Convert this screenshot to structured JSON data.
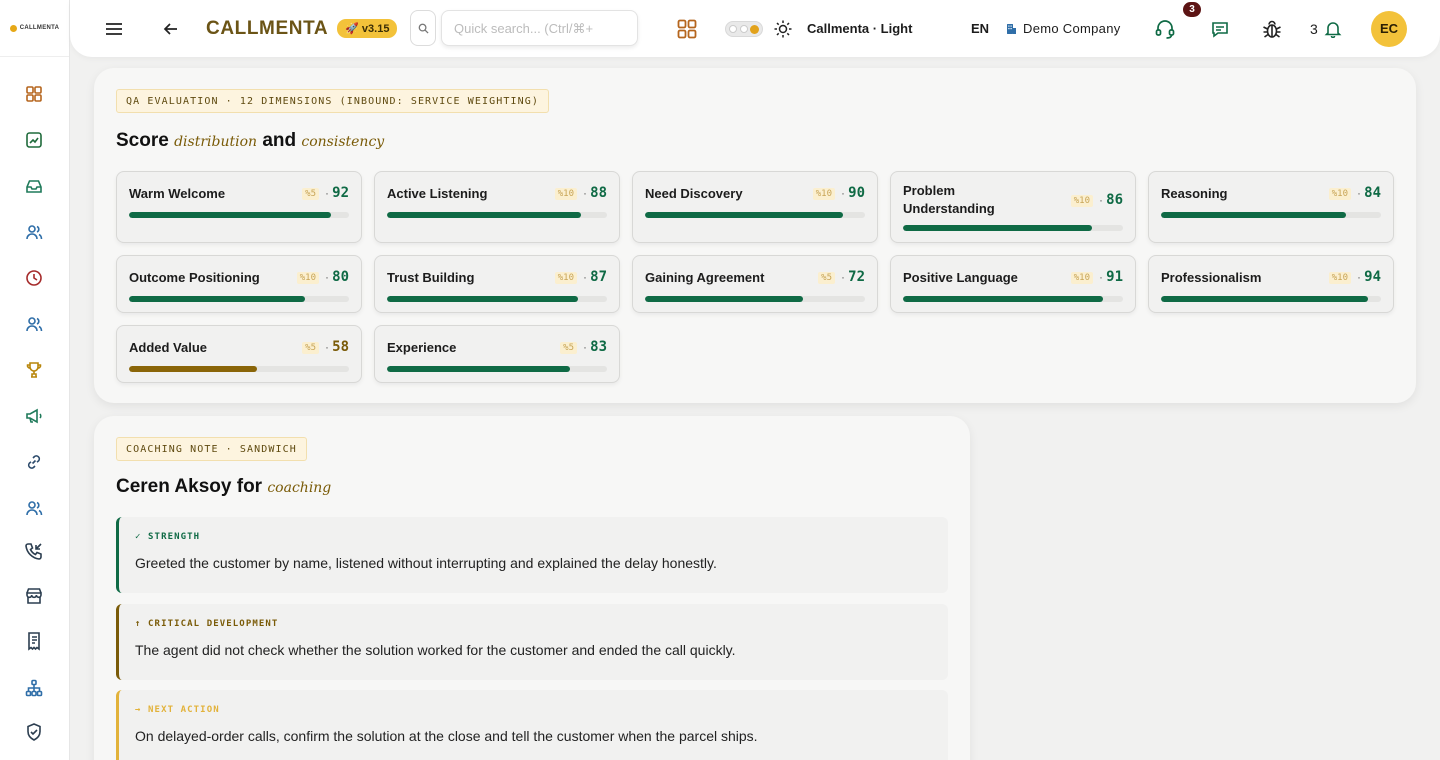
{
  "sidebar": {
    "logo_text": "CALLMENTA",
    "items": [
      {
        "name": "dashboard",
        "icon": "grid-icon",
        "color": "#b5651d"
      },
      {
        "name": "reports",
        "icon": "chart-square-icon",
        "color": "#1f6b3b"
      },
      {
        "name": "inbox",
        "icon": "inbox-icon",
        "color": "#1f7a5a"
      },
      {
        "name": "team",
        "icon": "users-icon",
        "color": "#2f6ea8"
      },
      {
        "name": "history",
        "icon": "clock-icon",
        "color": "#a52a2a"
      },
      {
        "name": "agents",
        "icon": "users-icon",
        "color": "#2f6ea8"
      },
      {
        "name": "leaderboard",
        "icon": "trophy-icon",
        "color": "#b8860b"
      },
      {
        "name": "campaigns",
        "icon": "megaphone-icon",
        "color": "#1f7a5a"
      },
      {
        "name": "integrations",
        "icon": "link-icon",
        "color": "#2c4a6b"
      },
      {
        "name": "customers",
        "icon": "users-icon",
        "color": "#2f6ea8"
      },
      {
        "name": "calls",
        "icon": "incoming-call-icon",
        "color": "#2c3e50"
      },
      {
        "name": "store",
        "icon": "store-icon",
        "color": "#2c3e50"
      },
      {
        "name": "documents",
        "icon": "receipt-icon",
        "color": "#2c3e50"
      },
      {
        "name": "org-chart",
        "icon": "sitemap-icon",
        "color": "#2f6ea8"
      },
      {
        "name": "security",
        "icon": "shield-icon",
        "color": "#2c3e50"
      }
    ]
  },
  "topbar": {
    "brand": "CALLMENTA",
    "version": "v3.15",
    "search_placeholder": "Quick search... (Ctrl/⌘+",
    "theme_label": "Callmenta · Light",
    "language": "EN",
    "company": "Demo Company",
    "support_badge": "3",
    "notification_count": "3",
    "avatar_initials": "EC"
  },
  "qa": {
    "eyebrow": "QA EVALUATION · 12 DIMENSIONS (INBOUND: SERVICE WEIGHTING)",
    "title_prefix": "Score",
    "title_accent1": "distribution",
    "title_and": "and",
    "title_accent2": "consistency",
    "dimensions": [
      {
        "name": "Warm Welcome",
        "weight": "%5",
        "score": 92,
        "low": false
      },
      {
        "name": "Active Listening",
        "weight": "%10",
        "score": 88,
        "low": false
      },
      {
        "name": "Need Discovery",
        "weight": "%10",
        "score": 90,
        "low": false
      },
      {
        "name": "Problem Understanding",
        "weight": "%10",
        "score": 86,
        "low": false
      },
      {
        "name": "Reasoning",
        "weight": "%10",
        "score": 84,
        "low": false
      },
      {
        "name": "Outcome Positioning",
        "weight": "%10",
        "score": 80,
        "low": false
      },
      {
        "name": "Trust Building",
        "weight": "%10",
        "score": 87,
        "low": false
      },
      {
        "name": "Gaining Agreement",
        "weight": "%5",
        "score": 72,
        "low": false
      },
      {
        "name": "Positive Language",
        "weight": "%10",
        "score": 91,
        "low": false
      },
      {
        "name": "Professionalism",
        "weight": "%10",
        "score": 94,
        "low": false
      },
      {
        "name": "Added Value",
        "weight": "%5",
        "score": 58,
        "low": true
      },
      {
        "name": "Experience",
        "weight": "%5",
        "score": 83,
        "low": false
      }
    ]
  },
  "coaching": {
    "eyebrow": "COACHING NOTE · SANDWICH",
    "title_name": "Ceren Aksoy for",
    "title_accent": "coaching",
    "notes": [
      {
        "tag": "✓ STRENGTH",
        "text": "Greeted the customer by name, listened without interrupting and explained the delay honestly.",
        "color": "#0f6a45"
      },
      {
        "tag": "↑ CRITICAL DEVELOPMENT",
        "text": "The agent did not check whether the solution worked for the customer and ended the call quickly.",
        "color": "#7a5b08"
      },
      {
        "tag": "→ NEXT ACTION",
        "text": "On delayed-order calls, confirm the solution at the close and tell the customer when the parcel ships.",
        "color": "#e2b23a"
      }
    ]
  }
}
